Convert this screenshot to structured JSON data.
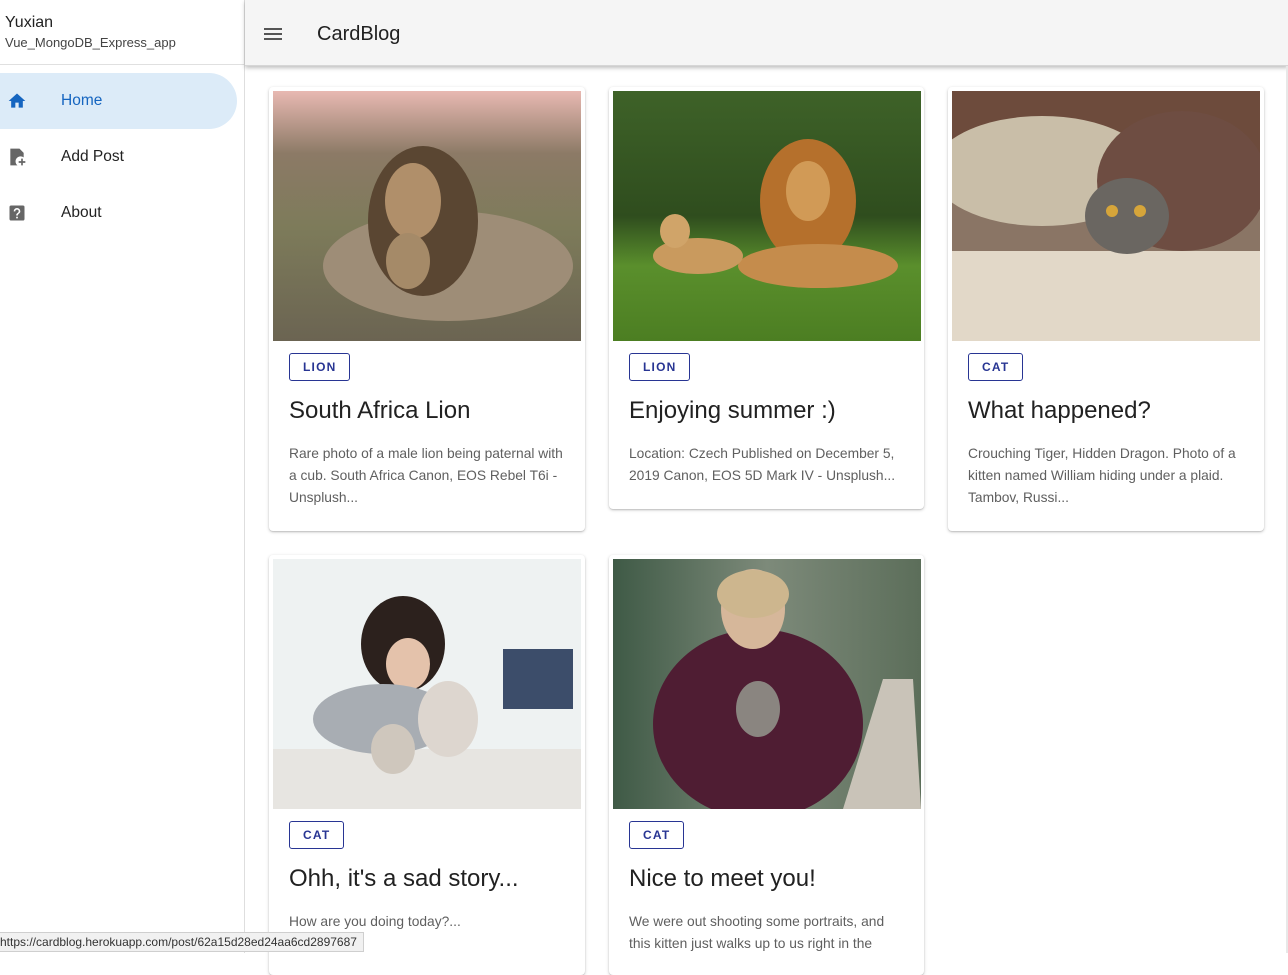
{
  "sidebar": {
    "user_name": "Yuxian",
    "user_sub": "Vue_MongoDB_Express_app",
    "items": [
      {
        "label": "Home",
        "icon": "home-icon",
        "active": true
      },
      {
        "label": "Add Post",
        "icon": "add-file-icon",
        "active": false
      },
      {
        "label": "About",
        "icon": "help-icon",
        "active": false
      }
    ]
  },
  "header": {
    "title": "CardBlog",
    "menu_icon": "menu-icon"
  },
  "cards": [
    {
      "tag": "LION",
      "title": "South Africa Lion",
      "description": "Rare photo of a male lion being paternal with a cub. South Africa Canon, EOS Rebel T6i - Unsplush..."
    },
    {
      "tag": "LION",
      "title": "Enjoying summer :)",
      "description": "Location: Czech Published on December 5, 2019 Canon, EOS 5D Mark IV - Unsplush..."
    },
    {
      "tag": "CAT",
      "title": "What happened?",
      "description": "Crouching Tiger, Hidden Dragon. Photo of a kitten named William hiding under a plaid. Tambov, Russi..."
    },
    {
      "tag": "CAT",
      "title": "Ohh, it's a sad story...",
      "description": "How are you doing today?..."
    },
    {
      "tag": "CAT",
      "title": "Nice to meet you!",
      "description": "We were out shooting some portraits, and this kitten just walks up to us right in the"
    }
  ],
  "status_bar": {
    "url": "https://cardblog.herokuapp.com/post/62a15d28ed24aa6cd2897687"
  },
  "colors": {
    "accent": "#1565c0",
    "active_bg": "#dcebf8",
    "chip": "#283593",
    "topbar": "#f5f5f5"
  }
}
